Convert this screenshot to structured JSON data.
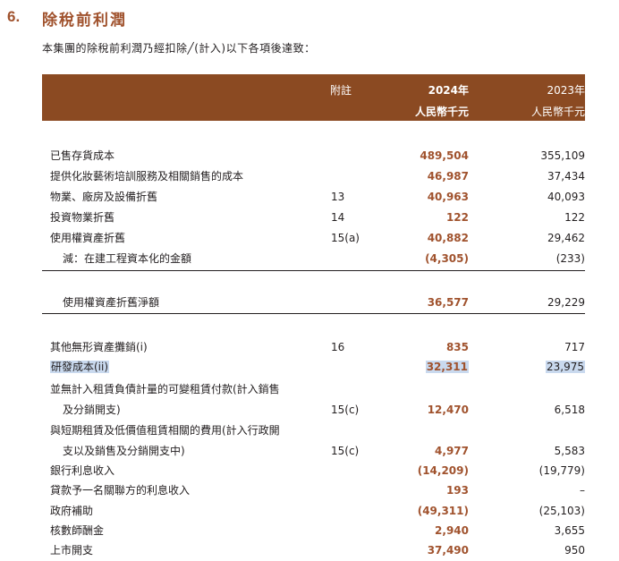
{
  "section": {
    "number": "6.",
    "title": "除稅前利潤",
    "intro": "本集團的除稅前利潤乃經扣除╱(計入)以下各項後達致："
  },
  "table_header": {
    "note": "附註",
    "year_current": "2024年",
    "year_prior": "2023年",
    "unit_current": "人民幣千元",
    "unit_prior": "人民幣千元"
  },
  "rows": [
    {
      "label": "已售存貨成本",
      "note": "",
      "v2024": "489,504",
      "v2023": "355,109"
    },
    {
      "label": "提供化妝藝術培訓服務及相關銷售的成本",
      "note": "",
      "v2024": "46,987",
      "v2023": "37,434"
    },
    {
      "label": "物業、廠房及設備折舊",
      "note": "13",
      "v2024": "40,963",
      "v2023": "40,093"
    },
    {
      "label": "投資物業折舊",
      "note": "14",
      "v2024": "122",
      "v2023": "122"
    },
    {
      "label": "使用權資產折舊",
      "note": "15(a)",
      "v2024": "40,882",
      "v2023": "29,462"
    },
    {
      "label": "減：在建工程資本化的金額",
      "note": "",
      "v2024": "(4,305)",
      "v2023": "(233)"
    },
    {
      "label": "使用權資產折舊淨額",
      "note": "",
      "v2024": "36,577",
      "v2023": "29,229"
    },
    {
      "label": "其他無形資產攤銷(i)",
      "note": "16",
      "v2024": "835",
      "v2023": "717"
    },
    {
      "label": "研發成本(ii)",
      "note": "",
      "v2024": "32,311",
      "v2023": "23,975"
    },
    {
      "label": "並無計入租賃負債計量的可變租賃付款(計入銷售",
      "note": "",
      "v2024": "",
      "v2023": ""
    },
    {
      "label": "及分銷開支)",
      "note": "15(c)",
      "v2024": "12,470",
      "v2023": "6,518"
    },
    {
      "label": "與短期租賃及低價值租賃相關的費用(計入行政開",
      "note": "",
      "v2024": "",
      "v2023": ""
    },
    {
      "label": "支以及銷售及分銷開支中)",
      "note": "15(c)",
      "v2024": "4,977",
      "v2023": "5,583"
    },
    {
      "label": "銀行利息收入",
      "note": "",
      "v2024": "(14,209)",
      "v2023": "(19,779)"
    },
    {
      "label": "貸款予一名關聯方的利息收入",
      "note": "",
      "v2024": "193",
      "v2023": "–"
    },
    {
      "label": "政府補助",
      "note": "",
      "v2024": "(49,311)",
      "v2023": "(25,103)"
    },
    {
      "label": "核數師酬金",
      "note": "",
      "v2024": "2,940",
      "v2023": "3,655"
    },
    {
      "label": "上市開支",
      "note": "",
      "v2024": "37,490",
      "v2023": "950"
    }
  ]
}
